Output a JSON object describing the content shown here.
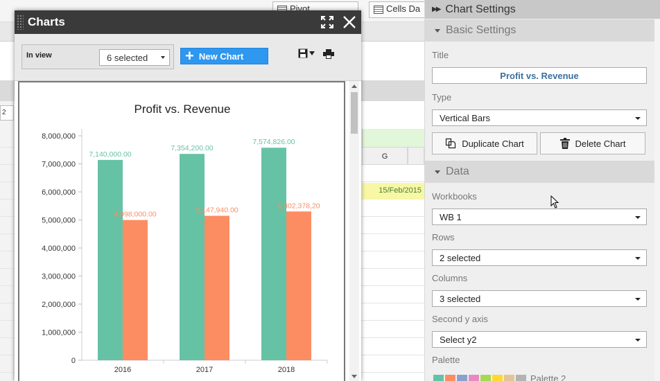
{
  "background": {
    "pivot_label": "Pivot",
    "cells_label": "Cells Da",
    "cell_ref": "2",
    "column_g": "G",
    "date_cell": "15/Feb/2015"
  },
  "dialog": {
    "title": "Charts",
    "in_view_label": "In view",
    "in_view_value": "6 selected",
    "new_chart_label": "New Chart",
    "icons": [
      "expand-icon",
      "close-icon",
      "save-icon",
      "print-icon"
    ]
  },
  "chart_data": {
    "type": "bar",
    "title": "Profit vs. Revenue",
    "categories": [
      "2016",
      "2017",
      "2018"
    ],
    "series": [
      {
        "values": [
          7140000,
          7354200,
          7574826
        ],
        "labels": [
          "7,140,000.00",
          "7,354,200.00",
          "7,574,826.00"
        ],
        "color": "#66c2a5"
      },
      {
        "values": [
          4998000,
          5147940,
          5302378.2
        ],
        "labels": [
          "4,998,000.00",
          "5,147,940.00",
          "5,302,378,20"
        ],
        "color": "#fc8d62"
      }
    ],
    "ylim": [
      0,
      8000000
    ],
    "yticks": [
      "0",
      "1,000,000",
      "2,000,000",
      "3,000,000",
      "4,000,000",
      "5,000,000",
      "6,000,000",
      "7,000,000",
      "8,000,000"
    ],
    "grid": false
  },
  "panel": {
    "header": "Chart Settings",
    "basic_settings": "Basic Settings",
    "title_label": "Title",
    "title_value": "Profit vs. Revenue",
    "type_label": "Type",
    "type_value": "Vertical Bars",
    "duplicate_label": "Duplicate Chart",
    "delete_label": "Delete Chart",
    "data_section": "Data",
    "workbooks_label": "Workbooks",
    "workbooks_value": "WB 1",
    "rows_label": "Rows",
    "rows_value": "2 selected",
    "columns_label": "Columns",
    "columns_value": "3 selected",
    "second_y_label": "Second y axis",
    "second_y_value": "Select y2",
    "palette_label": "Palette",
    "palette_value": "Palette 2",
    "palette_colors": [
      "#66c2a5",
      "#fc8d62",
      "#8da0cb",
      "#e78ac3",
      "#a6d854",
      "#ffd92f",
      "#e5c494",
      "#b3b3b3"
    ]
  }
}
